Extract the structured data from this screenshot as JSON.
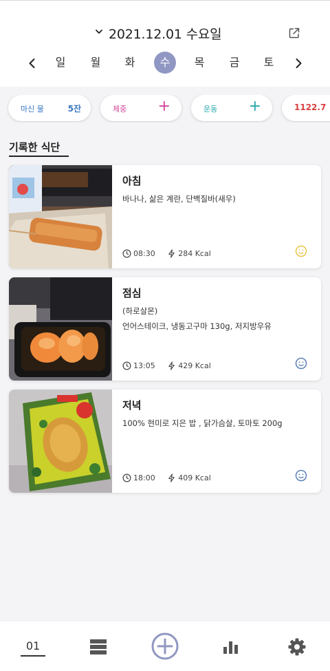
{
  "header": {
    "date": "2021.12.01 수요일",
    "icons": {
      "expand": "chevron-down-icon",
      "share": "external-link-icon"
    },
    "week": [
      "일",
      "월",
      "화",
      "수",
      "목",
      "금",
      "토"
    ],
    "selected_day": "수",
    "selected_color": "#9097c2"
  },
  "summary": {
    "water": {
      "label": "마신 물",
      "value": "5잔",
      "label_color": "#3a78c3",
      "value_color": "#3a78c3"
    },
    "weight": {
      "label": "체중",
      "action": "+",
      "color": "#d4449a"
    },
    "exercise": {
      "label": "운동",
      "action": "+",
      "color": "#29a8ac"
    },
    "calories": {
      "value": "1122.7",
      "color": "#d9403f"
    }
  },
  "diet": {
    "title": "기록한 식단",
    "meals": [
      {
        "name": "아침",
        "desc": [
          "바나나, 삶은 계란, 단백질바(새우)"
        ],
        "time": "08:30",
        "kcal": "284 Kcal",
        "mood_icon": "smile-icon",
        "mood_color": "#e8c44a"
      },
      {
        "name": "점심",
        "desc": [
          "(하로살몬)",
          "언어스테이크, 냉동고구마 130g, 저지방우유"
        ],
        "time": "13:05",
        "kcal": "429 Kcal",
        "mood_icon": "smile-icon",
        "mood_color": "#5b7fb8"
      },
      {
        "name": "저녁",
        "desc": [
          "100% 현미로 지은 밥 , 닭가슴살, 토마토 200g"
        ],
        "time": "18:00",
        "kcal": "409 Kcal",
        "mood_icon": "smile-icon",
        "mood_color": "#5b7fb8"
      }
    ]
  },
  "bottom_nav": {
    "today_label": "01",
    "icons": [
      "calendar-today-icon",
      "list-icon",
      "add-circle-icon",
      "bar-chart-icon",
      "gear-icon"
    ]
  }
}
